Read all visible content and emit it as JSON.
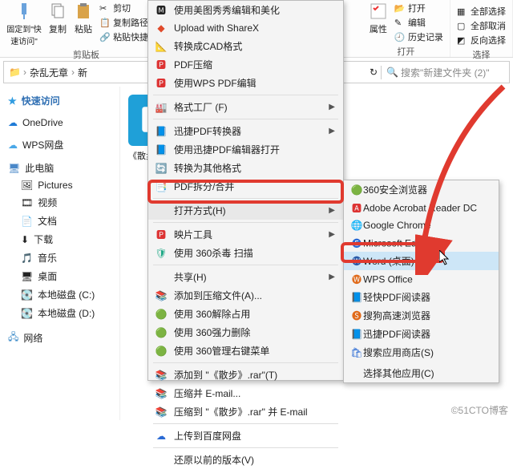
{
  "ribbon": {
    "pin_label": "固定到\"快速访问\"",
    "copy_label": "复制",
    "paste_label": "粘贴",
    "cut_label": "剪切",
    "copypath_label": "复制路径",
    "pasteshortcut_label": "粘贴快捷方式",
    "clipboard_group": "剪贴板",
    "props_label": "属性",
    "open_label": "打开",
    "edit_label": "编辑",
    "history_label": "历史记录",
    "open_group": "打开",
    "select_all": "全部选择",
    "select_none": "全部取消",
    "select_invert": "反向选择",
    "select_group": "选择"
  },
  "path": {
    "folder1": "杂乱无章",
    "folder2": "新",
    "search_placeholder": "搜索\"新建文件夹 (2)\""
  },
  "sidebar": {
    "quick": "快速访问",
    "onedrive": "OneDrive",
    "wps": "WPS网盘",
    "thispc": "此电脑",
    "pictures": "Pictures",
    "video": "视频",
    "docs": "文档",
    "downloads": "下载",
    "music": "音乐",
    "desktop": "桌面",
    "diskc": "本地磁盘 (C:)",
    "diskd": "本地磁盘 (D:)",
    "network": "网络"
  },
  "file": {
    "caption": "《散步"
  },
  "ctx": {
    "meitu": "使用美图秀秀编辑和美化",
    "sharex": "Upload with ShareX",
    "cad": "转换成CAD格式",
    "pdfzip": "PDF压缩",
    "wpspdf": "使用WPS PDF编辑",
    "factory": "格式工厂 (F)",
    "xunjie": "迅捷PDF转换器",
    "xunjieedit": "使用迅捷PDF编辑器打开",
    "convert": "转换为其他格式",
    "split": "PDF拆分/合并",
    "openwith": "打开方式(H)",
    "pictool": "映片工具",
    "scan360": "使用 360杀毒 扫描",
    "share": "共享(H)",
    "addzip": "添加到压缩文件(A)...",
    "unlock360": "使用 360解除占用",
    "force360": "使用 360强力删除",
    "rightmenu360": "使用 360管理右键菜单",
    "addto": "添加到 \"《散步》.rar\"(T)",
    "email": "压缩并 E-mail...",
    "emailrar": "压缩到 \"《散步》.rar\" 并 E-mail",
    "baidu": "上传到百度网盘",
    "restore": "还原以前的版本(V)"
  },
  "sub": {
    "safe360": "360安全浏览器",
    "acrobat": "Adobe Acrobat Reader DC",
    "chrome": "Google Chrome",
    "edge": "Microsoft Edge",
    "word": "Word (桌面)",
    "wpsoffice": "WPS Office",
    "light": "轻快PDF阅读器",
    "sogou": "搜狗高速浏览器",
    "xunjie2": "迅捷PDF阅读器",
    "store": "搜索应用商店(S)",
    "choose": "选择其他应用(C)"
  },
  "watermark": "©51CTO博客"
}
